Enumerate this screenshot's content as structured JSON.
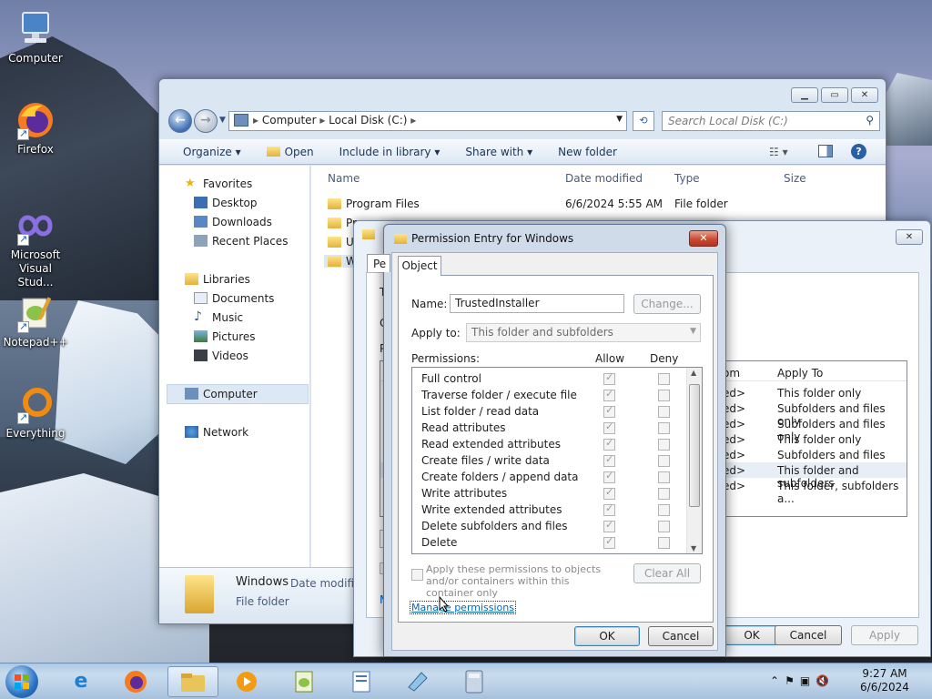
{
  "desktop": {
    "icons": [
      {
        "label": "Computer"
      },
      {
        "label": "Firefox"
      },
      {
        "label": "Microsoft Visual Stud..."
      },
      {
        "label": "Notepad++"
      },
      {
        "label": "Everything"
      }
    ]
  },
  "explorer": {
    "breadcrumb": [
      "Computer",
      "Local Disk (C:)"
    ],
    "search_placeholder": "Search Local Disk (C:)",
    "toolbar": {
      "organize": "Organize ▾",
      "open": "Open",
      "include_in_library": "Include in library ▾",
      "share_with": "Share with ▾",
      "new_folder": "New folder"
    },
    "nav": {
      "favorites": "Favorites",
      "desktop": "Desktop",
      "downloads": "Downloads",
      "recent_places": "Recent Places",
      "libraries": "Libraries",
      "documents": "Documents",
      "music": "Music",
      "pictures": "Pictures",
      "videos": "Videos",
      "computer": "Computer",
      "network": "Network"
    },
    "columns": {
      "name": "Name",
      "date_modified": "Date modified",
      "type": "Type",
      "size": "Size"
    },
    "rows": [
      {
        "name": "Program Files",
        "date": "6/6/2024 5:55 AM",
        "type": "File folder"
      },
      {
        "name": "Pr"
      },
      {
        "name": "U"
      },
      {
        "name": "W"
      }
    ],
    "details": {
      "name": "Windows",
      "date_label": "Date modifie",
      "type": "File folder"
    }
  },
  "props_window": {
    "tab_partial": "Pe",
    "letters": {
      "t": "T",
      "c": "C",
      "p": "P",
      "m": "M"
    },
    "apply_to_header": "Apply To",
    "from_header": "om",
    "rows": [
      {
        "from": "ed>",
        "apply_to": "This folder only"
      },
      {
        "from": "ed>",
        "apply_to": "Subfolders and files only"
      },
      {
        "from": "ed>",
        "apply_to": "Subfolders and files only"
      },
      {
        "from": "ed>",
        "apply_to": "This folder only"
      },
      {
        "from": "ed>",
        "apply_to": "Subfolders and files only"
      },
      {
        "from": "ed>",
        "apply_to": "This folder and subfolders"
      },
      {
        "from": "ed>",
        "apply_to": "This folder, subfolders a..."
      }
    ],
    "ok": "OK",
    "cancel": "Cancel",
    "apply": "Apply"
  },
  "perm_dialog": {
    "title": "Permission Entry for Windows",
    "tab": "Object",
    "name_label": "Name:",
    "name_value": "TrustedInstaller",
    "change_button": "Change...",
    "apply_to_label": "Apply to:",
    "apply_to_value": "This folder and subfolders",
    "permissions_label": "Permissions:",
    "allow_header": "Allow",
    "deny_header": "Deny",
    "permissions": [
      {
        "name": "Full control",
        "allow": true,
        "deny": false
      },
      {
        "name": "Traverse folder / execute file",
        "allow": true,
        "deny": false
      },
      {
        "name": "List folder / read data",
        "allow": true,
        "deny": false
      },
      {
        "name": "Read attributes",
        "allow": true,
        "deny": false
      },
      {
        "name": "Read extended attributes",
        "allow": true,
        "deny": false
      },
      {
        "name": "Create files / write data",
        "allow": true,
        "deny": false
      },
      {
        "name": "Create folders / append data",
        "allow": true,
        "deny": false
      },
      {
        "name": "Write attributes",
        "allow": true,
        "deny": false
      },
      {
        "name": "Write extended attributes",
        "allow": true,
        "deny": false
      },
      {
        "name": "Delete subfolders and files",
        "allow": true,
        "deny": false
      },
      {
        "name": "Delete",
        "allow": true,
        "deny": false
      }
    ],
    "apply_checkbox_label": "Apply these permissions to objects and/or containers within this container only",
    "clear_all": "Clear All",
    "manage_link": "Manage permissions",
    "ok": "OK",
    "cancel": "Cancel"
  },
  "taskbar": {
    "time": "9:27 AM",
    "date": "6/6/2024"
  }
}
